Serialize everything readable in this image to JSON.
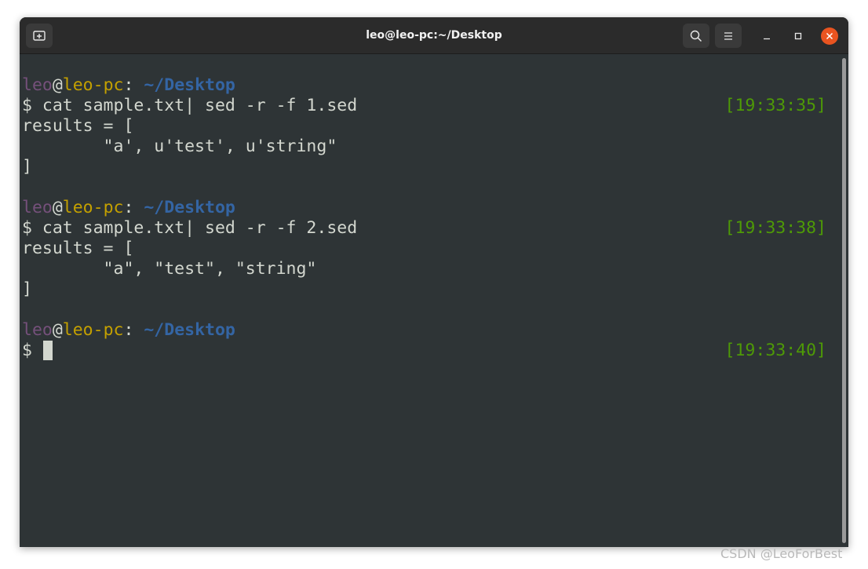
{
  "window": {
    "title": "leo@leo-pc:~/Desktop"
  },
  "titlebar": {
    "icons": [
      "new-tab-icon",
      "search-icon",
      "hamburger-menu-icon",
      "minimize-icon",
      "maximize-icon",
      "close-icon"
    ]
  },
  "colors": {
    "terminal_bg": "#2e3436",
    "terminal_fg": "#d3d7cf",
    "user": "#75507b",
    "host": "#c4a000",
    "path": "#3465a4",
    "timestamp": "#4e9a06",
    "close_button": "#e95420"
  },
  "terminal": {
    "prompt": {
      "user": "leo",
      "at": "@",
      "host": "leo-pc",
      "colon": ": ",
      "path": "~/Desktop",
      "dollar": "$ "
    },
    "blocks": [
      {
        "command": "cat sample.txt| sed -r -f 1.sed",
        "timestamp": "[19:33:35]",
        "output": [
          "results = [",
          "        \"a', u'test', u'string\"",
          "]"
        ]
      },
      {
        "command": "cat sample.txt| sed -r -f 2.sed",
        "timestamp": "[19:33:38]",
        "output": [
          "results = [",
          "        \"a\", \"test\", \"string\"",
          "]"
        ]
      }
    ],
    "current": {
      "timestamp": "[19:33:40]"
    }
  },
  "watermark": "CSDN @LeoForBest"
}
